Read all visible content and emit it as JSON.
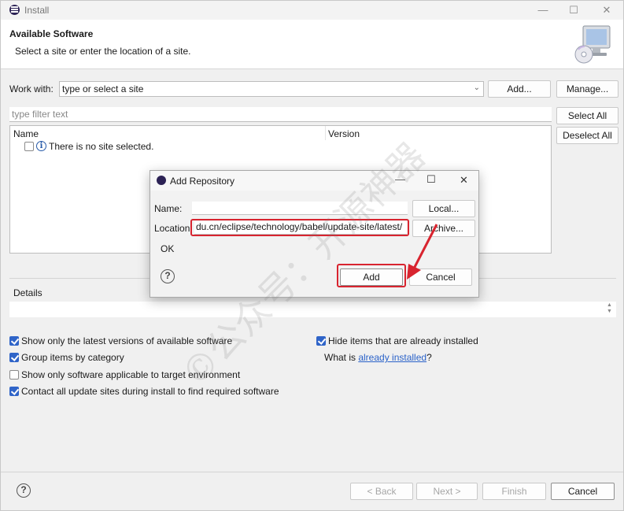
{
  "window": {
    "title": "Install",
    "minimize_glyph": "—",
    "maximize_glyph": "☐",
    "close_glyph": "✕"
  },
  "header": {
    "title": "Available Software",
    "description": "Select a site or enter the location of a site."
  },
  "work_with": {
    "label": "Work with:",
    "value": "type or select a site",
    "add_button": "Add...",
    "manage_button": "Manage..."
  },
  "filter": {
    "placeholder": "type filter text"
  },
  "side_buttons": {
    "select_all": "Select All",
    "deselect_all": "Deselect All"
  },
  "tree": {
    "columns": [
      "Name",
      "Version"
    ],
    "empty_message": "There is no site selected."
  },
  "details": {
    "label": "Details"
  },
  "options": {
    "left": [
      {
        "label": "Show only the latest versions of available software",
        "checked": true
      },
      {
        "label": "Group items by category",
        "checked": true
      },
      {
        "label": "Show only software applicable to target environment",
        "checked": false
      },
      {
        "label": "Contact all update sites during install to find required software",
        "checked": true
      }
    ],
    "right": [
      {
        "label": "Hide items that are already installed",
        "checked": true
      }
    ],
    "what_is_prefix": "What is ",
    "what_is_link": "already installed",
    "what_is_suffix": "?"
  },
  "footer": {
    "back": "< Back",
    "next": "Next >",
    "finish": "Finish",
    "cancel": "Cancel"
  },
  "dialog": {
    "title": "Add Repository",
    "name_label": "Name:",
    "name_value": "",
    "local_button": "Local...",
    "location_label": "Location:",
    "location_value": "du.cn/eclipse/technology/babel/update-site/latest/",
    "archive_button": "Archive...",
    "status": "OK",
    "add_button": "Add",
    "cancel_button": "Cancel"
  },
  "watermark": {
    "text": "©公众号：开源神器"
  },
  "colors": {
    "accent": "#2f64c8",
    "highlight": "#d8242f",
    "link": "#2a62c9"
  }
}
